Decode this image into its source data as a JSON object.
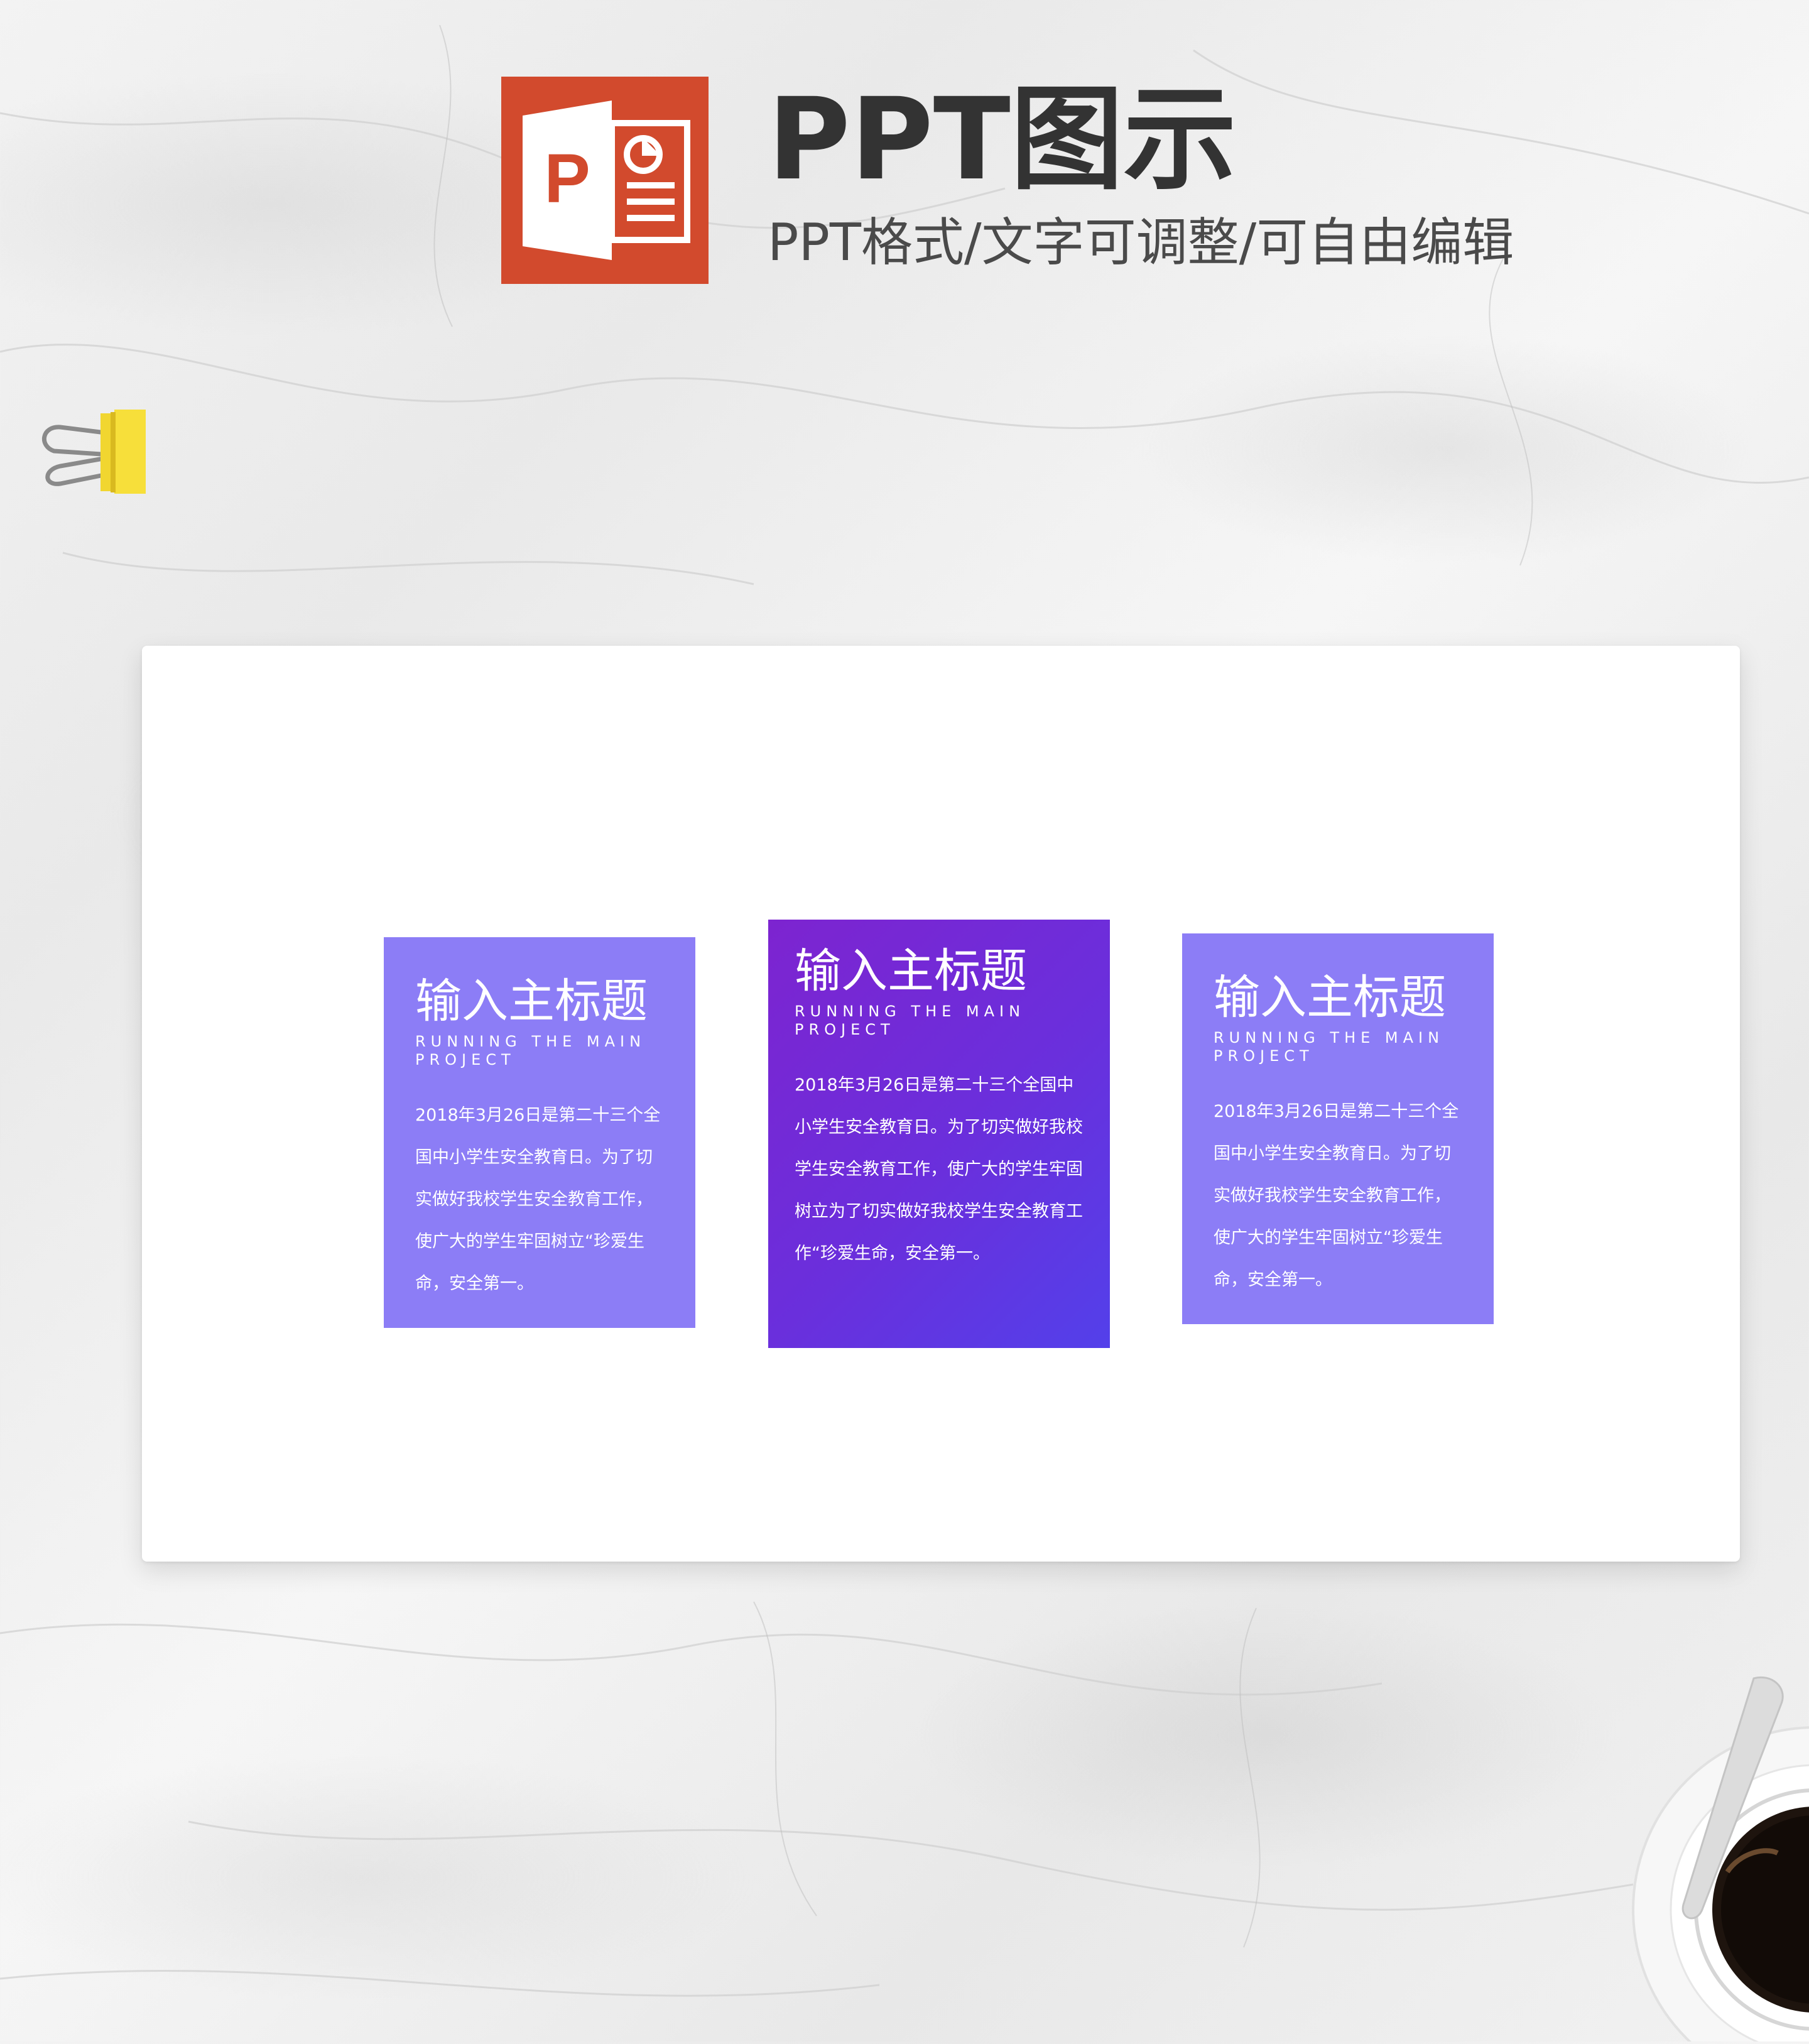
{
  "header": {
    "title": "PPT图示",
    "subtitle": "PPT格式/文字可调整/可自由编辑",
    "logo_color": "#d24a2d"
  },
  "icons": {
    "logo": "powerpoint-icon",
    "decor_left": "binder-clip-icon",
    "decor_right": "coffee-cup-icon"
  },
  "cards": [
    {
      "title": "输入主标题",
      "subtitle": "RUNNING THE MAIN PROJECT",
      "body": "2018年3月26日是第二十三个全国中小学生安全教育日。为了切实做好我校学生安全教育工作，使广大的学生牢固树立“珍爱生命，安全第一。",
      "color": "#8c7df6"
    },
    {
      "title": "输入主标题",
      "subtitle": "RUNNING THE MAIN PROJECT",
      "body": "2018年3月26日是第二十三个全国中小学生安全教育日。为了切实做好我校学生安全教育工作，使广大的学生牢固树立为了切实做好我校学生安全教育工作“珍爱生命，安全第一。",
      "color": "#6a2fdc"
    },
    {
      "title": "输入主标题",
      "subtitle": "RUNNING THE MAIN PROJECT",
      "body": "2018年3月26日是第二十三个全国中小学生安全教育日。为了切实做好我校学生安全教育工作，使广大的学生牢固树立“珍爱生命，安全第一。",
      "color": "#8c7df6"
    }
  ]
}
